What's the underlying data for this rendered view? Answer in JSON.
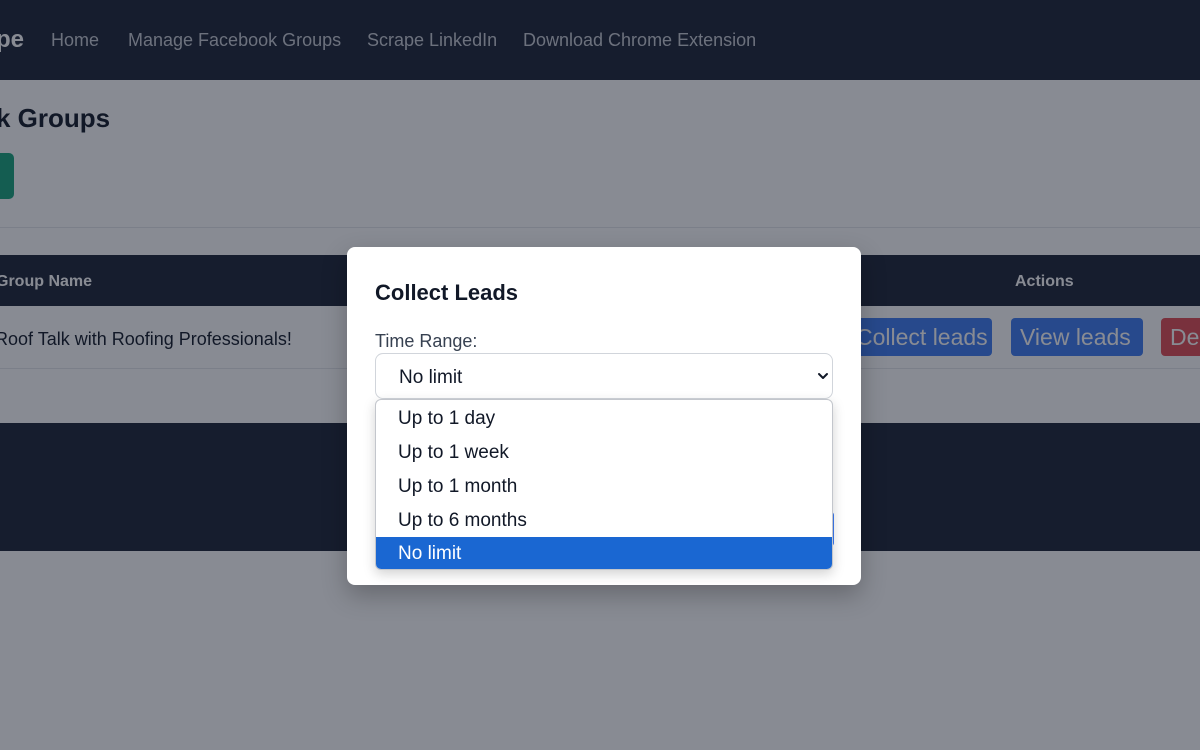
{
  "nav": {
    "brand": "pe",
    "links": [
      "Home",
      "Manage Facebook Groups",
      "Scrape LinkedIn",
      "Download Chrome Extension"
    ]
  },
  "page": {
    "title": "k Groups"
  },
  "table": {
    "headers": {
      "group_name": "Group Name",
      "actions": "Actions"
    },
    "rows": [
      {
        "group_name": "Roof Talk with Roofing Professionals!",
        "actions": [
          "Collect leads",
          "View leads",
          "De"
        ]
      }
    ]
  },
  "modal": {
    "title": "Collect Leads",
    "time_range_label": "Time Range:",
    "time_range_value": "No limit",
    "options": [
      "Up to 1 day",
      "Up to 1 week",
      "Up to 1 month",
      "Up to 6 months",
      "No limit"
    ],
    "selected_option": "No limit"
  },
  "colors": {
    "navbar": "#1a2234",
    "primary_button": "#3d7bf0",
    "danger_button": "#e04b52",
    "add_button": "#16a37a",
    "option_highlight": "#1a67d2"
  },
  "icons": {
    "select_chevron": "chevron-down-icon"
  }
}
